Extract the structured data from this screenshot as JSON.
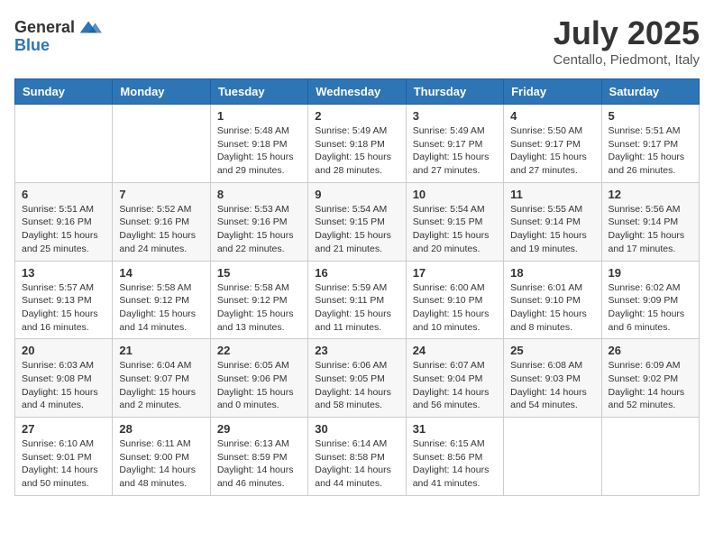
{
  "header": {
    "logo_line1": "General",
    "logo_line2": "Blue",
    "month": "July 2025",
    "location": "Centallo, Piedmont, Italy"
  },
  "days_of_week": [
    "Sunday",
    "Monday",
    "Tuesday",
    "Wednesday",
    "Thursday",
    "Friday",
    "Saturday"
  ],
  "weeks": [
    [
      {
        "day": "",
        "info": ""
      },
      {
        "day": "",
        "info": ""
      },
      {
        "day": "1",
        "info": "Sunrise: 5:48 AM\nSunset: 9:18 PM\nDaylight: 15 hours\nand 29 minutes."
      },
      {
        "day": "2",
        "info": "Sunrise: 5:49 AM\nSunset: 9:18 PM\nDaylight: 15 hours\nand 28 minutes."
      },
      {
        "day": "3",
        "info": "Sunrise: 5:49 AM\nSunset: 9:17 PM\nDaylight: 15 hours\nand 27 minutes."
      },
      {
        "day": "4",
        "info": "Sunrise: 5:50 AM\nSunset: 9:17 PM\nDaylight: 15 hours\nand 27 minutes."
      },
      {
        "day": "5",
        "info": "Sunrise: 5:51 AM\nSunset: 9:17 PM\nDaylight: 15 hours\nand 26 minutes."
      }
    ],
    [
      {
        "day": "6",
        "info": "Sunrise: 5:51 AM\nSunset: 9:16 PM\nDaylight: 15 hours\nand 25 minutes."
      },
      {
        "day": "7",
        "info": "Sunrise: 5:52 AM\nSunset: 9:16 PM\nDaylight: 15 hours\nand 24 minutes."
      },
      {
        "day": "8",
        "info": "Sunrise: 5:53 AM\nSunset: 9:16 PM\nDaylight: 15 hours\nand 22 minutes."
      },
      {
        "day": "9",
        "info": "Sunrise: 5:54 AM\nSunset: 9:15 PM\nDaylight: 15 hours\nand 21 minutes."
      },
      {
        "day": "10",
        "info": "Sunrise: 5:54 AM\nSunset: 9:15 PM\nDaylight: 15 hours\nand 20 minutes."
      },
      {
        "day": "11",
        "info": "Sunrise: 5:55 AM\nSunset: 9:14 PM\nDaylight: 15 hours\nand 19 minutes."
      },
      {
        "day": "12",
        "info": "Sunrise: 5:56 AM\nSunset: 9:14 PM\nDaylight: 15 hours\nand 17 minutes."
      }
    ],
    [
      {
        "day": "13",
        "info": "Sunrise: 5:57 AM\nSunset: 9:13 PM\nDaylight: 15 hours\nand 16 minutes."
      },
      {
        "day": "14",
        "info": "Sunrise: 5:58 AM\nSunset: 9:12 PM\nDaylight: 15 hours\nand 14 minutes."
      },
      {
        "day": "15",
        "info": "Sunrise: 5:58 AM\nSunset: 9:12 PM\nDaylight: 15 hours\nand 13 minutes."
      },
      {
        "day": "16",
        "info": "Sunrise: 5:59 AM\nSunset: 9:11 PM\nDaylight: 15 hours\nand 11 minutes."
      },
      {
        "day": "17",
        "info": "Sunrise: 6:00 AM\nSunset: 9:10 PM\nDaylight: 15 hours\nand 10 minutes."
      },
      {
        "day": "18",
        "info": "Sunrise: 6:01 AM\nSunset: 9:10 PM\nDaylight: 15 hours\nand 8 minutes."
      },
      {
        "day": "19",
        "info": "Sunrise: 6:02 AM\nSunset: 9:09 PM\nDaylight: 15 hours\nand 6 minutes."
      }
    ],
    [
      {
        "day": "20",
        "info": "Sunrise: 6:03 AM\nSunset: 9:08 PM\nDaylight: 15 hours\nand 4 minutes."
      },
      {
        "day": "21",
        "info": "Sunrise: 6:04 AM\nSunset: 9:07 PM\nDaylight: 15 hours\nand 2 minutes."
      },
      {
        "day": "22",
        "info": "Sunrise: 6:05 AM\nSunset: 9:06 PM\nDaylight: 15 hours\nand 0 minutes."
      },
      {
        "day": "23",
        "info": "Sunrise: 6:06 AM\nSunset: 9:05 PM\nDaylight: 14 hours\nand 58 minutes."
      },
      {
        "day": "24",
        "info": "Sunrise: 6:07 AM\nSunset: 9:04 PM\nDaylight: 14 hours\nand 56 minutes."
      },
      {
        "day": "25",
        "info": "Sunrise: 6:08 AM\nSunset: 9:03 PM\nDaylight: 14 hours\nand 54 minutes."
      },
      {
        "day": "26",
        "info": "Sunrise: 6:09 AM\nSunset: 9:02 PM\nDaylight: 14 hours\nand 52 minutes."
      }
    ],
    [
      {
        "day": "27",
        "info": "Sunrise: 6:10 AM\nSunset: 9:01 PM\nDaylight: 14 hours\nand 50 minutes."
      },
      {
        "day": "28",
        "info": "Sunrise: 6:11 AM\nSunset: 9:00 PM\nDaylight: 14 hours\nand 48 minutes."
      },
      {
        "day": "29",
        "info": "Sunrise: 6:13 AM\nSunset: 8:59 PM\nDaylight: 14 hours\nand 46 minutes."
      },
      {
        "day": "30",
        "info": "Sunrise: 6:14 AM\nSunset: 8:58 PM\nDaylight: 14 hours\nand 44 minutes."
      },
      {
        "day": "31",
        "info": "Sunrise: 6:15 AM\nSunset: 8:56 PM\nDaylight: 14 hours\nand 41 minutes."
      },
      {
        "day": "",
        "info": ""
      },
      {
        "day": "",
        "info": ""
      }
    ]
  ]
}
